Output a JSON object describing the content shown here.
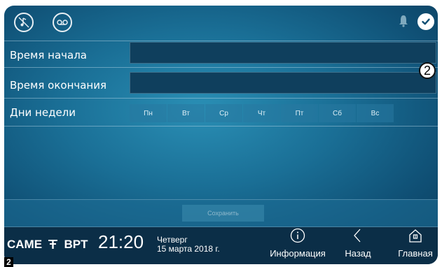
{
  "topbar": {
    "icons": [
      "music-mute-icon",
      "voicemail-icon",
      "bell-icon",
      "check-icon"
    ]
  },
  "form": {
    "start_time_label": "Время начала",
    "end_time_label": "Время окончания",
    "weekdays_label": "Дни недели",
    "start_time_value": "",
    "end_time_value": "",
    "days": [
      "Пн",
      "Вт",
      "Ср",
      "Чт",
      "Пт",
      "Сб",
      "Вс"
    ],
    "save_label": "Сохранить"
  },
  "annotation_marker": "2",
  "corner_marker": "2",
  "statusbar": {
    "brand": "CAME ⸭ BPT",
    "brand_parts": [
      "CAME",
      "BPT"
    ],
    "time": "21:20",
    "weekday": "Четверг",
    "date": "15 марта 2018 г.",
    "nav": [
      {
        "label": "Информация",
        "icon": "info-icon"
      },
      {
        "label": "Назад",
        "icon": "back-chevron-icon"
      },
      {
        "label": "Главная",
        "icon": "home-icon"
      }
    ]
  },
  "colors": {
    "panel_center": "#2a8fb5",
    "panel_edge": "#0b3d5c",
    "field_bg": "#0f3f5d",
    "bottombar_bg": "#0b2e47",
    "text": "#ffffff"
  }
}
